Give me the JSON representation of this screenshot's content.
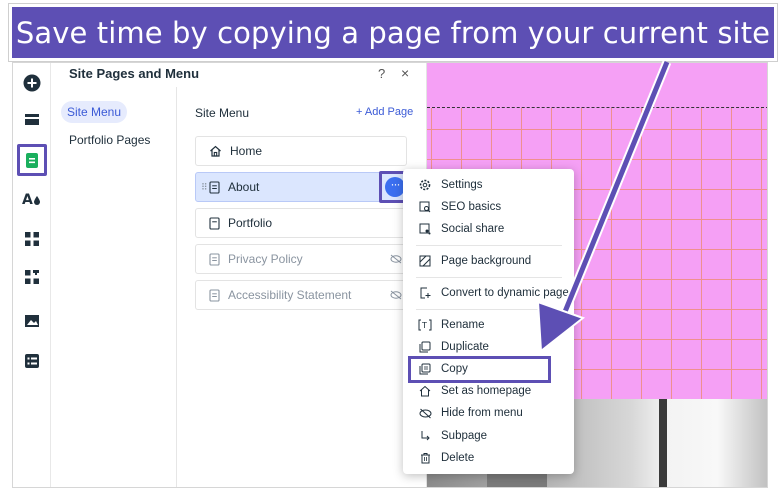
{
  "banner": {
    "text": "Save time by copying a page from your current site"
  },
  "rail": {
    "items": [
      {
        "icon": "add-icon"
      },
      {
        "icon": "menu-icon"
      },
      {
        "icon": "pages-icon",
        "highlighted": true
      },
      {
        "icon": "design-icon"
      },
      {
        "icon": "apps-icon"
      },
      {
        "icon": "app-market-icon"
      },
      {
        "icon": "media-icon"
      },
      {
        "icon": "cms-icon"
      }
    ]
  },
  "panel": {
    "title": "Site Pages and Menu",
    "help": "?",
    "close": "×",
    "nav": {
      "active": "Site Menu",
      "other": "Portfolio Pages"
    },
    "section_title": "Site Menu",
    "add_page": "+ Add Page",
    "pages": [
      {
        "label": "Home",
        "icon": "home-icon"
      },
      {
        "label": "About",
        "icon": "page-icon",
        "selected": true
      },
      {
        "label": "Portfolio",
        "icon": "page-icon"
      },
      {
        "label": "Privacy Policy",
        "icon": "page-icon",
        "hidden": true
      },
      {
        "label": "Accessibility Statement",
        "icon": "page-icon",
        "hidden": true
      }
    ],
    "more_button": "···"
  },
  "context_menu": {
    "items": [
      {
        "label": "Settings",
        "icon": "gear-icon"
      },
      {
        "label": "SEO basics",
        "icon": "seo-icon"
      },
      {
        "label": "Social share",
        "icon": "share-icon"
      },
      {
        "label": "Page background",
        "icon": "background-icon"
      },
      {
        "label": "Convert to dynamic page",
        "icon": "dynamic-page-icon"
      },
      {
        "label": "Rename",
        "icon": "rename-icon"
      },
      {
        "label": "Duplicate",
        "icon": "duplicate-icon"
      },
      {
        "label": "Copy",
        "icon": "copy-icon",
        "highlighted": true
      },
      {
        "label": "Set as homepage",
        "icon": "home-icon"
      },
      {
        "label": "Hide from menu",
        "icon": "hide-icon"
      },
      {
        "label": "Subpage",
        "icon": "subpage-icon"
      },
      {
        "label": "Delete",
        "icon": "trash-icon"
      }
    ]
  },
  "colors": {
    "accent": "#5d4fb4",
    "link": "#3b5ad6",
    "canvas_grid": "#f5a0f5"
  }
}
